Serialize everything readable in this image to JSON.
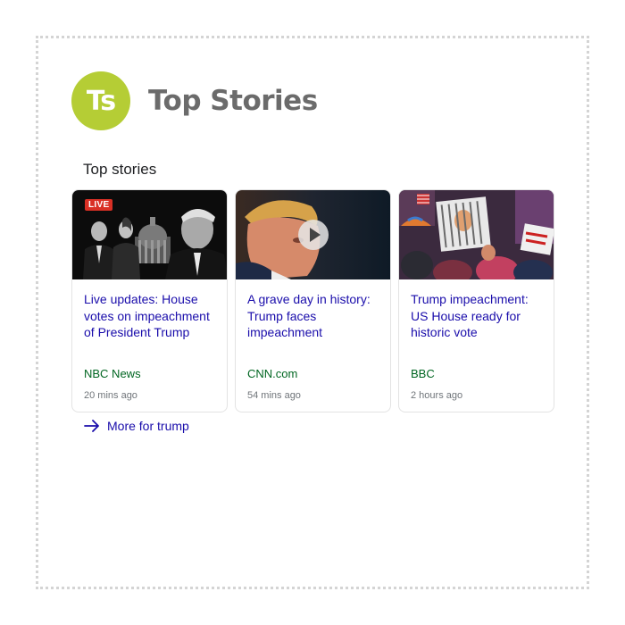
{
  "header": {
    "logo_text": "Ts",
    "logo_color": "#b5cd35",
    "title": "Top Stories"
  },
  "section": {
    "heading": "Top stories"
  },
  "cards": [
    {
      "image": "politicians-capitol-photo",
      "badge": "LIVE",
      "title": "Live updates: House votes on impeachment of President Trump",
      "source": "NBC News",
      "time": "20 mins ago"
    },
    {
      "image": "trump-portrait-photo",
      "video": "play-icon",
      "title": "A grave day in history: Trump faces impeachment",
      "source": "CNN.com",
      "time": "54 mins ago"
    },
    {
      "image": "protest-crowd-photo",
      "title": "Trump impeachment: US House ready for historic vote",
      "source": "BBC",
      "time": "2 hours ago"
    }
  ],
  "more": {
    "icon": "arrow-right-icon",
    "label": "More for trump"
  },
  "colors": {
    "link": "#1a0dab",
    "source": "#006621",
    "meta": "#70757a",
    "live": "#d93025"
  }
}
